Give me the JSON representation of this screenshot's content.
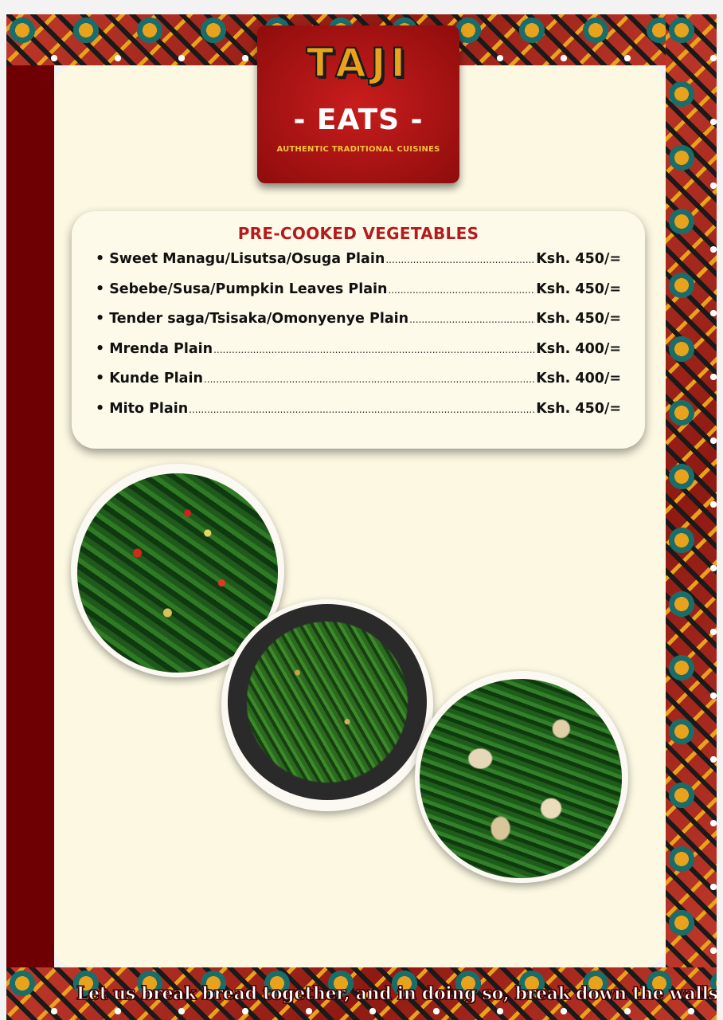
{
  "brand": {
    "name": "TAJI",
    "subname": "- EATS -",
    "tagline": "AUTHENTIC TRADITIONAL CUISINES"
  },
  "menu": {
    "heading": "PRE-COOKED VEGETABLES",
    "items": [
      {
        "name": "Sweet Managu/Lisutsa/Osuga Plain",
        "price": "Ksh. 450/="
      },
      {
        "name": "Sebebe/Susa/Pumpkin Leaves Plain",
        "price": "Ksh. 450/="
      },
      {
        "name": "Tender saga/Tsisaka/Omonyenye Plain",
        "price": "Ksh. 450/="
      },
      {
        "name": "Mrenda Plain",
        "price": "Ksh. 400/="
      },
      {
        "name": "Kunde Plain",
        "price": "Ksh. 400/="
      },
      {
        "name": "Mito Plain",
        "price": "Ksh. 450/="
      }
    ]
  },
  "footer": {
    "slogan": "Let us break bread together, and in doing so, break down the walls tha"
  }
}
